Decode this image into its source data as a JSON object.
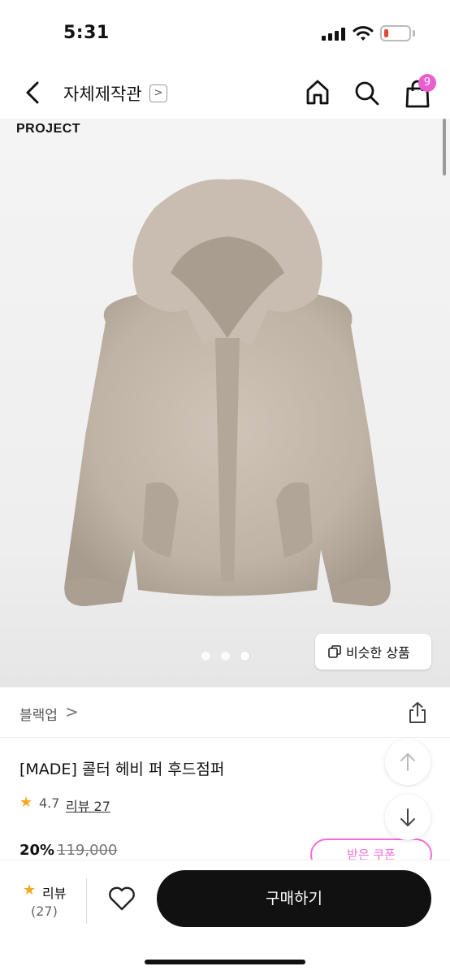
{
  "status_bar": {
    "time": "5:31",
    "battery_level": 0.15
  },
  "nav": {
    "title": "자체제작관",
    "title_chevron": ">",
    "cart_count": "9"
  },
  "hero": {
    "brand_wordmark": "PROJECT",
    "carousel": {
      "total": 3,
      "active_index": 2
    },
    "similar_button_label": "비슷한 상품"
  },
  "product": {
    "brand_name": "블랙업",
    "brand_chevron": ">",
    "title": "[MADE] 콜터 헤비 퍼 후드점퍼",
    "rating_star": "★",
    "rating": "4.7",
    "review_link": "리뷰 27",
    "discount": "20%",
    "original_price": "119,000",
    "coupon_label": "받은 쿠폰"
  },
  "bottom_bar": {
    "review_star": "★",
    "review_label": "리뷰",
    "review_count": "(27)",
    "buy_label": "구매하기"
  },
  "colors": {
    "accent_pink": "#ea5fd0",
    "star": "#f5a623",
    "buy_button": "#111111",
    "battery_low": "#e9443a"
  },
  "icons": [
    "back-arrow-icon",
    "home-icon",
    "search-icon",
    "shopping-bag-icon",
    "copy-icon",
    "share-icon",
    "arrow-up-icon",
    "arrow-down-icon",
    "heart-icon",
    "star-icon"
  ]
}
